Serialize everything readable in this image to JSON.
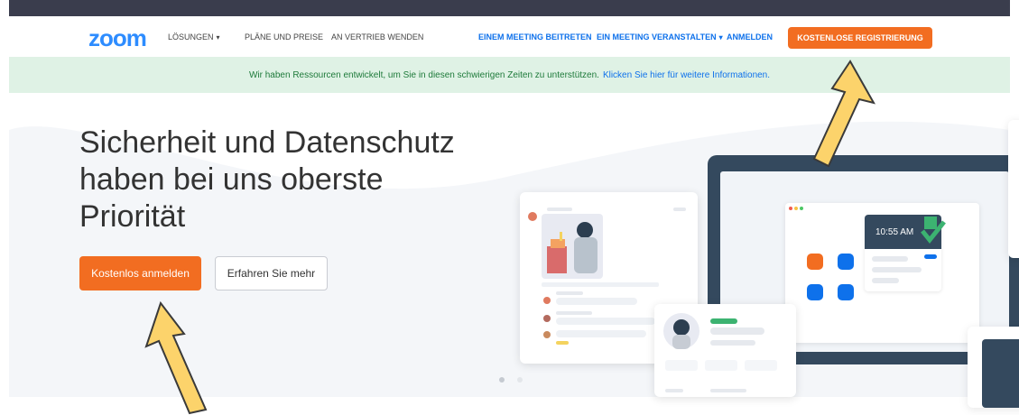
{
  "nav": {
    "logo": "zoom",
    "items": [
      {
        "label": "LÖSUNGEN",
        "chevron": true
      },
      {
        "label": "PLÄNE UND PREISE"
      },
      {
        "label": "AN VERTRIEB WENDEN"
      }
    ],
    "right_items": [
      {
        "label": "EINEM MEETING BEITRETEN"
      },
      {
        "label": "EIN MEETING VERANSTALTEN",
        "chevron": true
      },
      {
        "label": "ANMELDEN"
      }
    ],
    "signup_label": "KOSTENLOSE REGISTRIERUNG"
  },
  "banner": {
    "text": "Wir haben Ressourcen entwickelt, um Sie in diesen schwierigen Zeiten zu unterstützen.",
    "link": "Klicken Sie hier für weitere Informationen."
  },
  "hero": {
    "title_lines": [
      "Sicherheit und Datenschutz",
      "haben bei uns oberste",
      "Priorität"
    ],
    "primary_button": "Kostenlos anmelden",
    "secondary_button": "Erfahren Sie mehr"
  },
  "illustration": {
    "time": "10:55 AM"
  },
  "colors": {
    "brand": "#2d8cff",
    "accent_orange": "#f26d21",
    "banner_bg": "#dff2e5",
    "link_blue": "#0e71eb",
    "annotation_arrow": "#fcd36b"
  },
  "icons": [
    "chevron-down-icon",
    "video-icon",
    "calendar-icon",
    "share-screen-icon",
    "check-icon",
    "annotation-arrow-icon"
  ]
}
